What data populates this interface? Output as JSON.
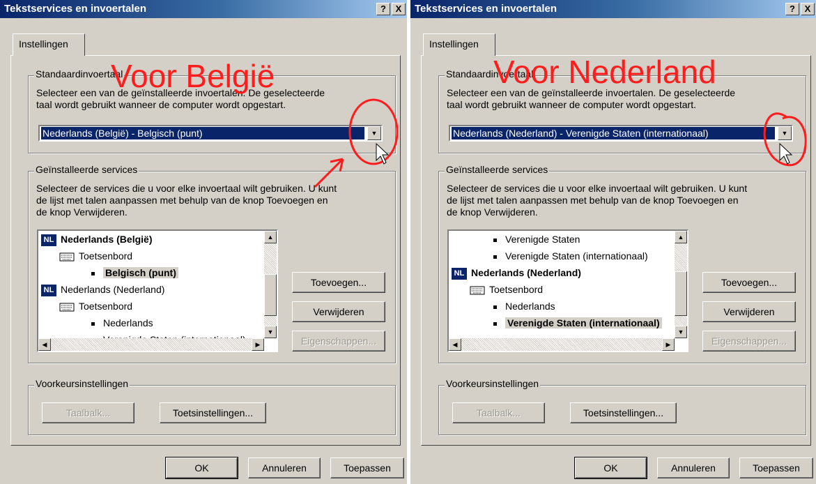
{
  "dialogs": [
    {
      "title": "Tekstservices en invoertalen",
      "help_btn": "?",
      "close_btn": "X",
      "tab_label": "Instellingen",
      "annotation": "Voor België",
      "default_group": {
        "legend": "Standaardinvoertaal",
        "description_line1": "Selecteer een van de geïnstalleerde invoertalen. De geselecteerde",
        "description_line2": "taal wordt gebruikt wanneer de computer wordt opgestart.",
        "selected_value": "Nederlands (België) - Belgisch (punt)"
      },
      "services_group": {
        "legend": "Geïnstalleerde services",
        "description_line1": "Selecteer de services die u voor elke invoertaal wilt gebruiken. U kunt",
        "description_line2": "de lijst met talen aanpassen met behulp van de knop Toevoegen en",
        "description_line3": "de knop Verwijderen.",
        "list": [
          "Nederlands (België)",
          "Toetsenbord",
          "Belgisch (punt)",
          "Nederlands (Nederland)",
          "Toetsenbord",
          "Nederlands",
          "Verenigde Staten (internationaal)"
        ],
        "lang_badge": "NL",
        "add_button": "Toevoegen...",
        "remove_button": "Verwijderen",
        "properties_button": "Eigenschappen..."
      },
      "prefs_group": {
        "legend": "Voorkeursinstellingen",
        "langbar_button": "Taalbalk...",
        "keys_button": "Toetsinstellingen..."
      },
      "ok_button": "OK",
      "cancel_button": "Annuleren",
      "apply_button": "Toepassen"
    },
    {
      "title": "Tekstservices en invoertalen",
      "help_btn": "?",
      "close_btn": "X",
      "tab_label": "Instellingen",
      "annotation": "Voor Nederland",
      "default_group": {
        "legend": "Standaardinvoertaal",
        "description_line1": "Selecteer een van de geïnstalleerde invoertalen. De geselecteerde",
        "description_line2": "taal wordt gebruikt wanneer de computer wordt opgestart.",
        "selected_value": "Nederlands (Nederland) - Verenigde Staten (internationaal)"
      },
      "services_group": {
        "legend": "Geïnstalleerde services",
        "description_line1": "Selecteer de services die u voor elke invoertaal wilt gebruiken. U kunt",
        "description_line2": "de lijst met talen aanpassen met behulp van de knop Toevoegen en",
        "description_line3": "de knop Verwijderen.",
        "list": [
          "Verenigde Staten",
          "Verenigde Staten (internationaal)",
          "Nederlands (Nederland)",
          "Toetsenbord",
          "Nederlands",
          "Verenigde Staten (internationaal)"
        ],
        "lang_badge": "NL",
        "add_button": "Toevoegen...",
        "remove_button": "Verwijderen",
        "properties_button": "Eigenschappen..."
      },
      "prefs_group": {
        "legend": "Voorkeursinstellingen",
        "langbar_button": "Taalbalk...",
        "keys_button": "Toetsinstellingen..."
      },
      "ok_button": "OK",
      "cancel_button": "Annuleren",
      "apply_button": "Toepassen"
    }
  ],
  "colors": {
    "annotation_red": "#ff1c1c",
    "titlebar": "#0a246a",
    "dialog_bg": "#d4d0c8",
    "selection": "#0a246a"
  },
  "icons": [
    "help-icon",
    "close-icon",
    "dropdown-arrow-icon",
    "keyboard-icon",
    "language-badge-icon",
    "scroll-up-icon",
    "scroll-down-icon",
    "scroll-left-icon",
    "scroll-right-icon",
    "mouse-cursor-icon"
  ]
}
